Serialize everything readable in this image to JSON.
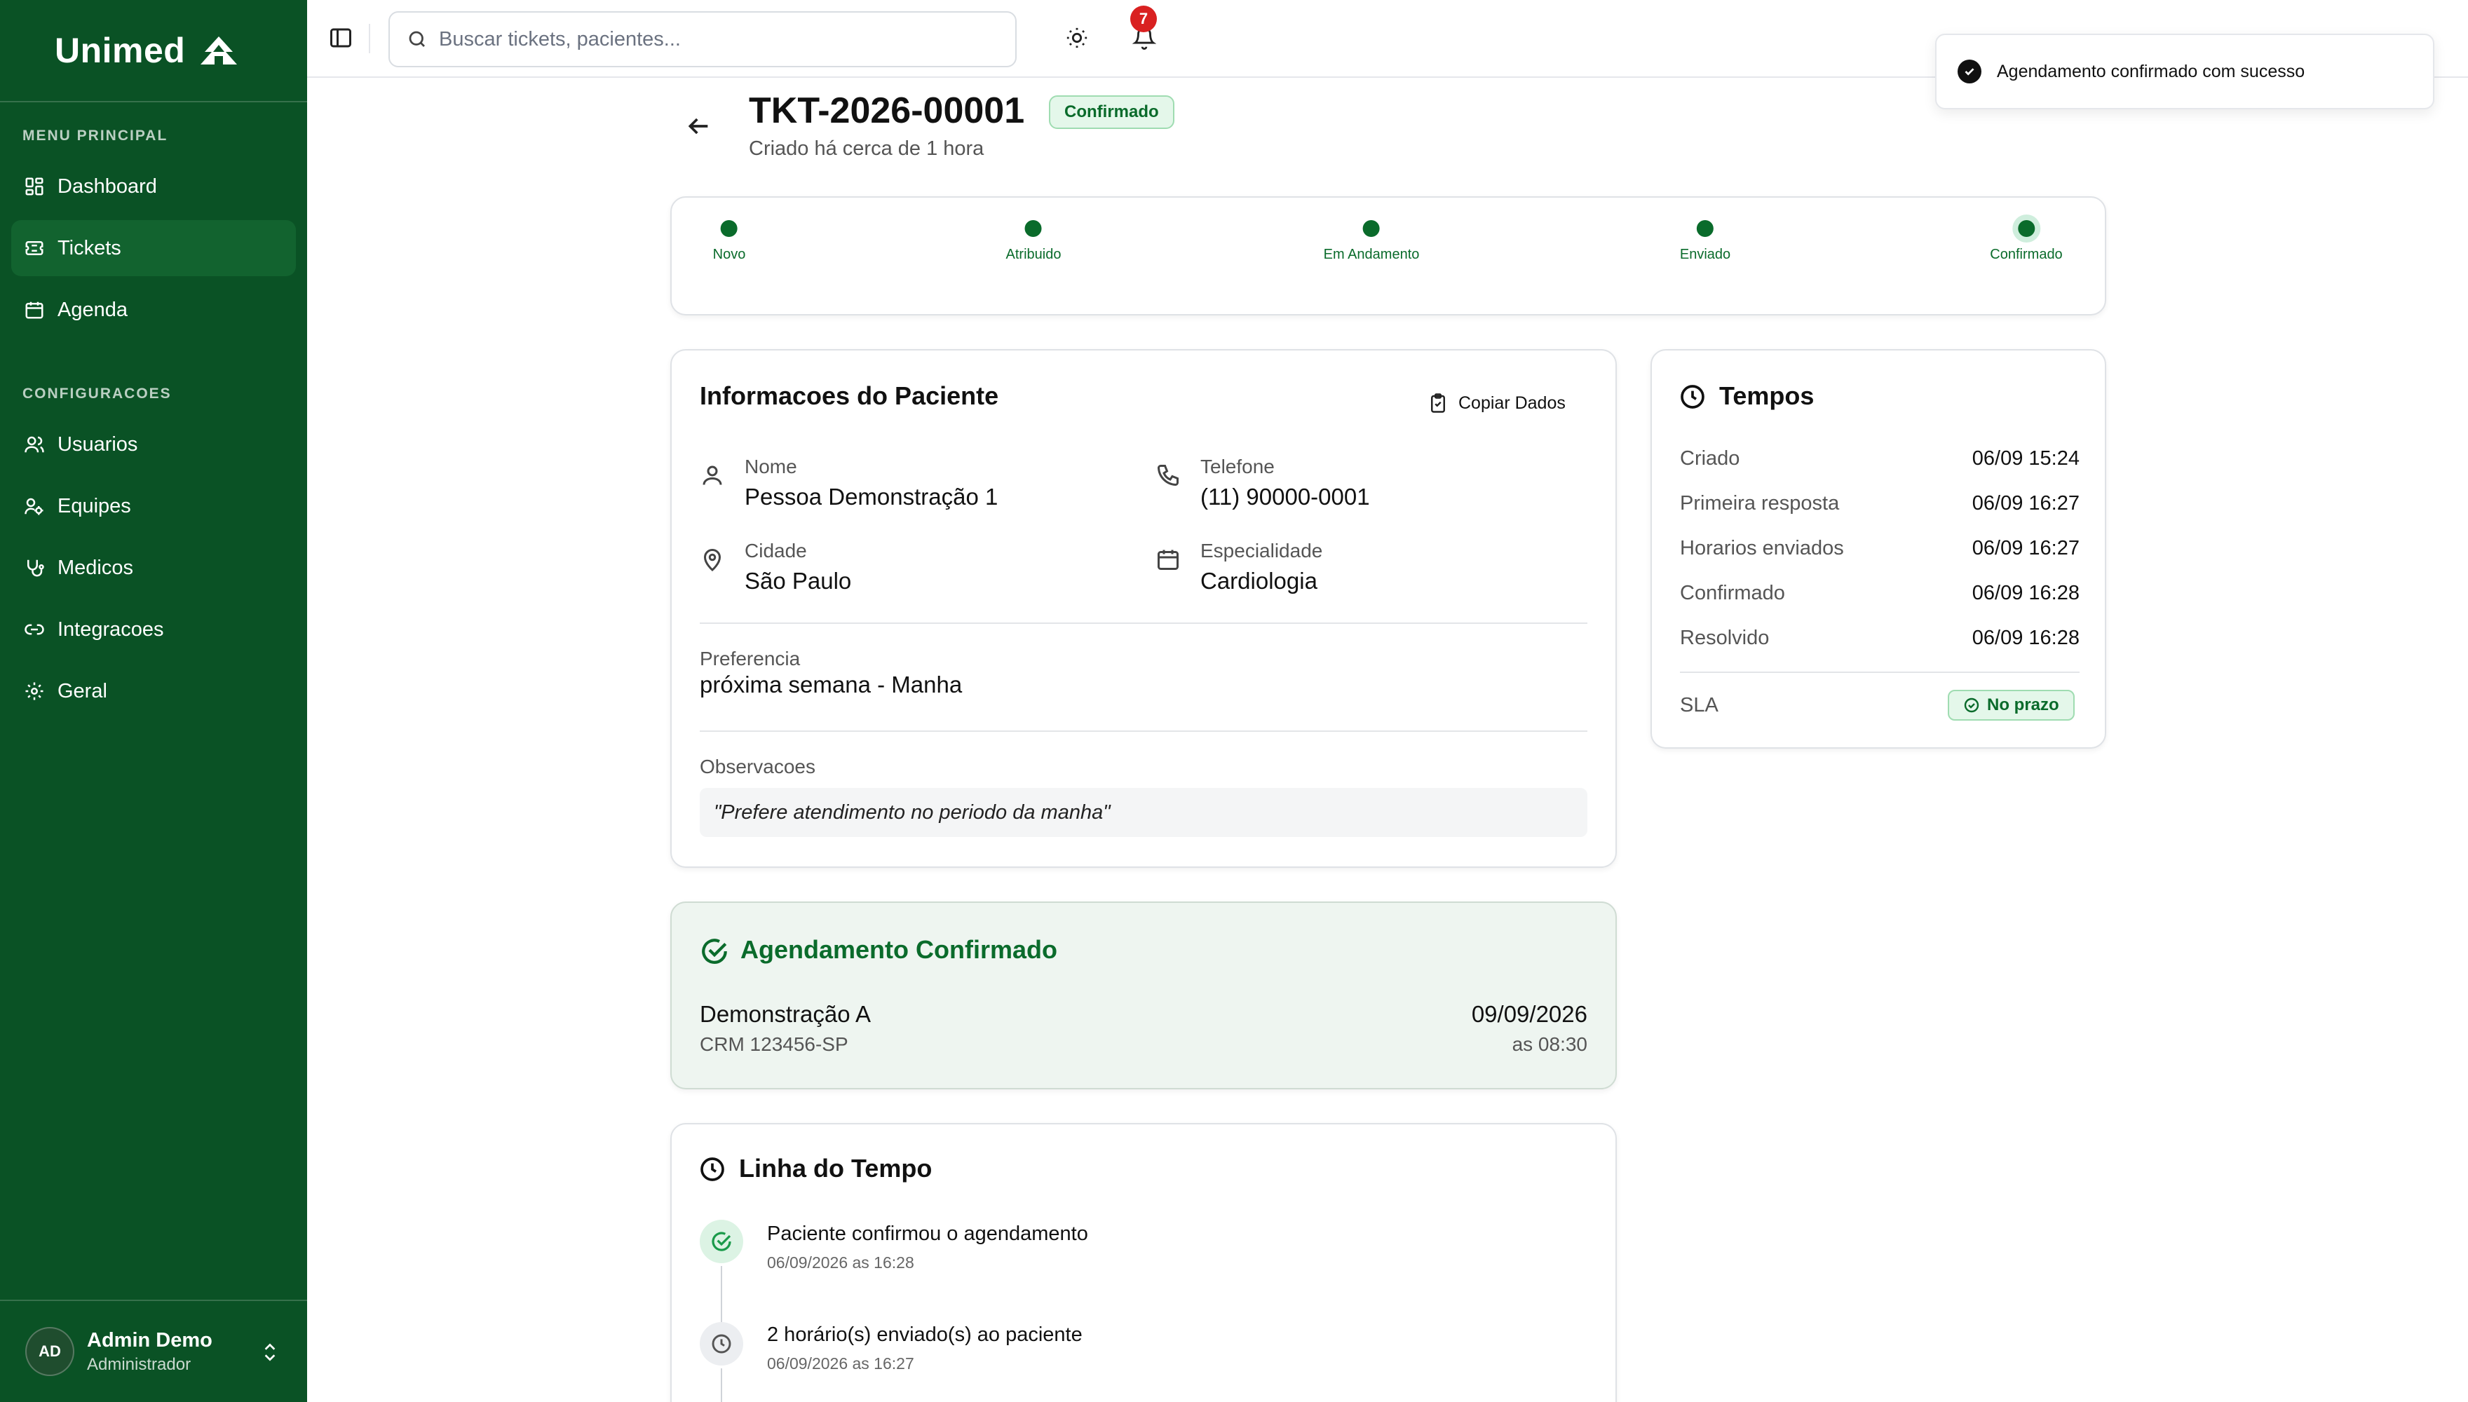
{
  "brand": {
    "name": "Unimed",
    "color": "#0a5225"
  },
  "sidebar": {
    "section_main": "MENU PRINCIPAL",
    "section_config": "CONFIGURACOES",
    "items": [
      {
        "label": "Dashboard",
        "icon": "dashboard-icon"
      },
      {
        "label": "Tickets",
        "icon": "ticket-icon",
        "active": true
      },
      {
        "label": "Agenda",
        "icon": "calendar-icon"
      },
      {
        "label": "Usuarios",
        "icon": "users-icon"
      },
      {
        "label": "Equipes",
        "icon": "team-icon"
      },
      {
        "label": "Medicos",
        "icon": "stethoscope-icon"
      },
      {
        "label": "Integracoes",
        "icon": "link-icon"
      },
      {
        "label": "Geral",
        "icon": "gear-icon"
      }
    ],
    "user": {
      "initials": "AD",
      "name": "Admin Demo",
      "role": "Administrador"
    }
  },
  "header": {
    "search_placeholder": "Buscar tickets, pacientes...",
    "notification_count": "7"
  },
  "toast": {
    "message": "Agendamento confirmado com sucesso"
  },
  "ticket": {
    "id": "TKT-2026-00001",
    "status": "Confirmado",
    "created": "Criado há cerca de 1 hora"
  },
  "steps": [
    {
      "label": "Novo"
    },
    {
      "label": "Atribuido"
    },
    {
      "label": "Em Andamento"
    },
    {
      "label": "Enviado"
    },
    {
      "label": "Confirmado"
    }
  ],
  "patient": {
    "title": "Informacoes do Paciente",
    "copy_label": "Copiar Dados",
    "nome_label": "Nome",
    "nome": "Pessoa Demonstração 1",
    "telefone_label": "Telefone",
    "telefone": "(11) 90000-0001",
    "cidade_label": "Cidade",
    "cidade": "São Paulo",
    "especialidade_label": "Especialidade",
    "especialidade": "Cardiologia",
    "preferencia_label": "Preferencia",
    "preferencia": "próxima semana - Manha",
    "observacoes_label": "Observacoes",
    "observacoes": "\"Prefere atendimento no periodo da manha\""
  },
  "tempos": {
    "title": "Tempos",
    "rows": [
      {
        "label": "Criado",
        "value": "06/09 15:24"
      },
      {
        "label": "Primeira resposta",
        "value": "06/09 16:27"
      },
      {
        "label": "Horarios enviados",
        "value": "06/09 16:27"
      },
      {
        "label": "Confirmado",
        "value": "06/09 16:28"
      },
      {
        "label": "Resolvido",
        "value": "06/09 16:28"
      }
    ],
    "sla_label": "SLA",
    "sla_status": "No prazo"
  },
  "agendamento": {
    "title": "Agendamento Confirmado",
    "doctor": "Demonstração A",
    "crm": "CRM 123456-SP",
    "date": "09/09/2026",
    "time": "as 08:30"
  },
  "timeline": {
    "title": "Linha do Tempo",
    "events": [
      {
        "title": "Paciente confirmou o agendamento",
        "time": "06/09/2026 as 16:28"
      },
      {
        "title": "2 horário(s) enviado(s) ao paciente",
        "time": "06/09/2026 as 16:27"
      }
    ]
  }
}
